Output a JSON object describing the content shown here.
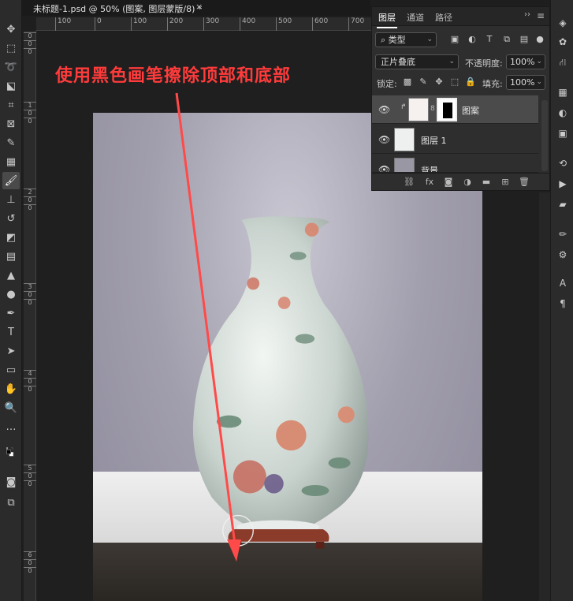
{
  "document_tab": {
    "title": "未标题-1.psd @ 50% (图案, 图层蒙版/8) *",
    "close": "×"
  },
  "rulers": {
    "horizontal": [
      "100",
      "0",
      "100",
      "200",
      "300",
      "400",
      "500",
      "600",
      "700"
    ],
    "vertical": [
      "0",
      "0",
      "0",
      "1",
      "0",
      "0",
      "2",
      "0",
      "0",
      "3",
      "0",
      "0",
      "4",
      "0",
      "0",
      "5",
      "0",
      "0",
      "6",
      "0",
      "0"
    ]
  },
  "annotation": {
    "text": "使用黑色画笔擦除顶部和底部",
    "color": "#ff3b3b"
  },
  "layers_panel": {
    "tabs": [
      "图层",
      "通道",
      "路径"
    ],
    "filter_type": "类型",
    "blend_mode": "正片叠底",
    "opacity_label": "不透明度:",
    "opacity_value": "100%",
    "lock_label": "锁定:",
    "fill_label": "填充:",
    "fill_value": "100%",
    "layers": [
      {
        "name": "图案",
        "visible": true,
        "selected": true,
        "has_mask": true,
        "clipped": true
      },
      {
        "name": "图层 1",
        "visible": true,
        "selected": false
      },
      {
        "name": "背景",
        "visible": true,
        "selected": false
      }
    ]
  },
  "colors": {
    "accent": "#ff3b3b",
    "panel_bg": "#2e2e2e",
    "toolbar_bg": "#2b2b2b"
  }
}
